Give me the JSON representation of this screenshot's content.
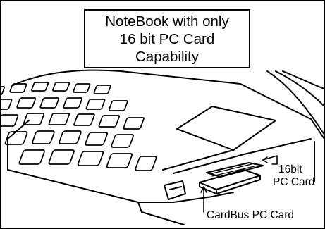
{
  "title_lines": [
    "NoteBook with only",
    "16 bit PC Card",
    "Capability"
  ],
  "labels": {
    "card_16bit_line1": "16bit",
    "card_16bit_line2": "PC Card",
    "cardbus": "CardBus PC Card"
  },
  "colors": {
    "ink": "#000000",
    "paper": "#ffffff"
  }
}
